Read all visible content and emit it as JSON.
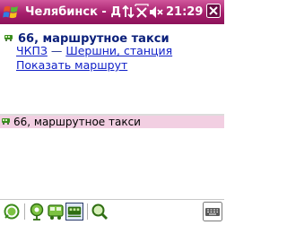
{
  "status_bar": {
    "title": "Челябинск - Д",
    "time": "21:29",
    "icons": [
      "windows-start-icon",
      "connectivity-icon",
      "no-signal-icon",
      "volume-muted-icon",
      "close-icon"
    ]
  },
  "details": {
    "route_title": "66, маршрутное такси",
    "stop_from": "ЧКПЗ",
    "separator": "—",
    "stop_to": "Шершни, станция",
    "show_route_link": "Показать маршрут"
  },
  "list": {
    "items": [
      {
        "label": "66, маршрутное такси",
        "selected": true
      }
    ]
  },
  "toolbar": {
    "buttons": [
      "search-icon",
      "stops-icon",
      "bus-routes-icon",
      "tram-routes-icon",
      "find-icon",
      "keyboard-icon"
    ],
    "selected_index": 3
  },
  "colors": {
    "titlebar": "#a61f6c",
    "selected_item": "#f2cfe2",
    "link": "#1020c8",
    "heading": "#0a1f7a"
  }
}
